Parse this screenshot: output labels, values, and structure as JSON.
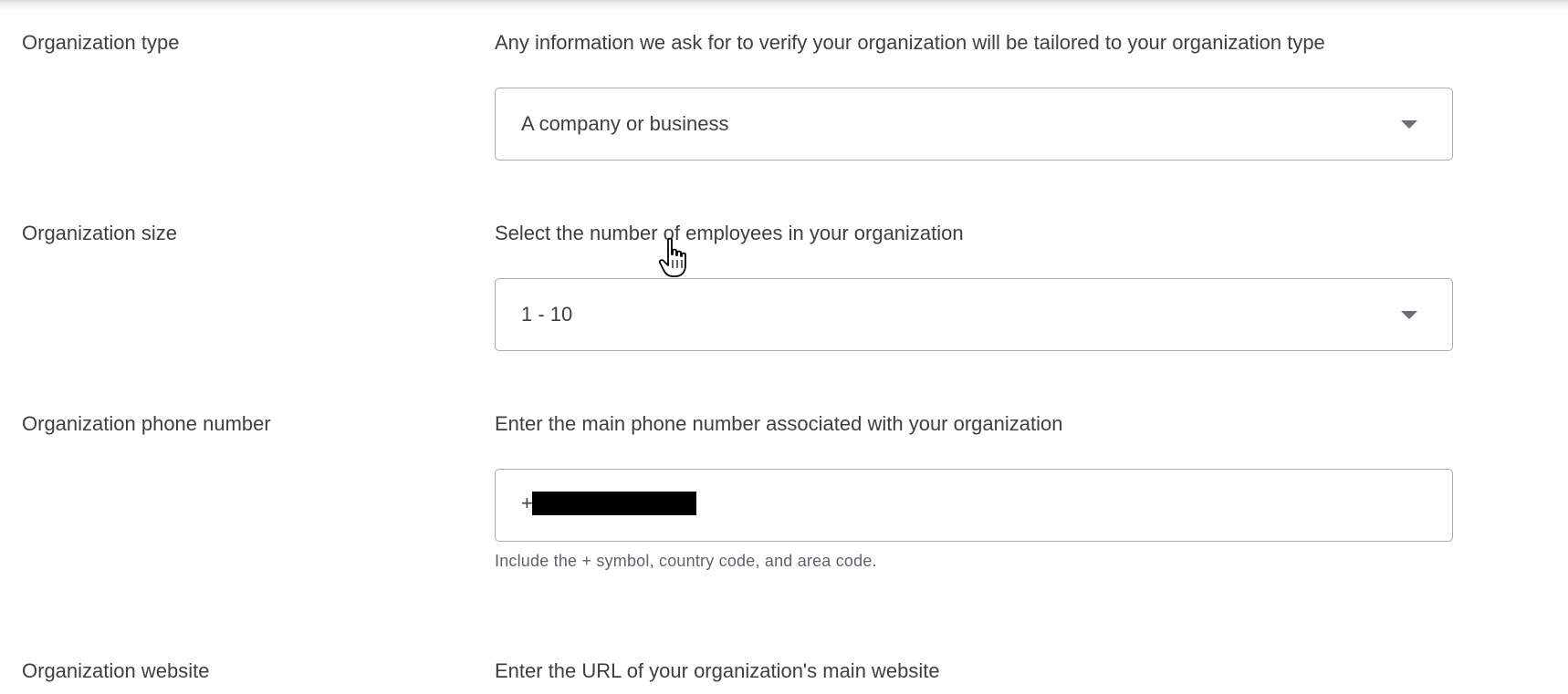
{
  "form": {
    "rows": [
      {
        "label": "Organization type",
        "description": "Any information we ask for to verify your organization will be tailored to your organization type",
        "field_type": "select",
        "value": "A company or business"
      },
      {
        "label": "Organization size",
        "description": "Select the number of employees in your organization",
        "field_type": "select",
        "value": "1 - 10"
      },
      {
        "label": "Organization phone number",
        "description": "Enter the main phone number associated with your organization",
        "field_type": "text",
        "value": "+",
        "value_redacted": true,
        "hint": "Include the + symbol, country code, and area code."
      },
      {
        "label": "Organization website",
        "description": "Enter the URL of your organization's main website"
      }
    ]
  },
  "icons": {
    "dropdown": "arrow-drop-down-icon",
    "cursor": "hand-pointer-cursor"
  },
  "colors": {
    "text": "#3c4043",
    "hint_text": "#5f6368",
    "field_border": "#a8abaf",
    "redaction": "#000000"
  }
}
